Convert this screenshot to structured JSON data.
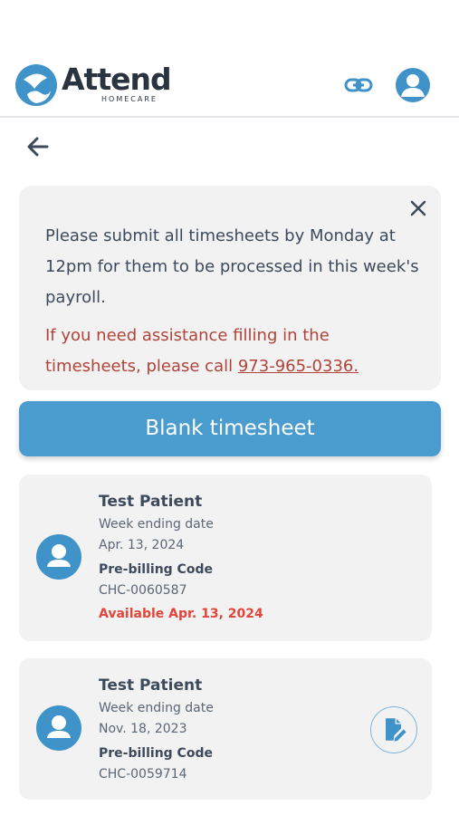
{
  "header": {
    "logo_word": "Attend",
    "logo_sub": "HOMECARE"
  },
  "notice": {
    "text": "Please submit all timesheets by Monday at 12pm for them to be processed in this week's payroll.",
    "help_text": "If you need assistance filling in the timesheets, please call ",
    "phone": "973-965-0336."
  },
  "blank_button": {
    "label": "Blank timesheet"
  },
  "timesheets": [
    {
      "patient": "Test Patient",
      "week_label": "Week ending date",
      "week_date": "Apr. 13, 2024",
      "code_label": "Pre-billing Code",
      "code": "CHC-0060587",
      "availability": "Available Apr. 13, 2024"
    },
    {
      "patient": "Test Patient",
      "week_label": "Week ending date",
      "week_date": "Nov. 18, 2023",
      "code_label": "Pre-billing Code",
      "code": "CHC-0059714"
    }
  ],
  "colors": {
    "accent": "#4a9ccf",
    "warning_text": "#b0443a",
    "available_text": "#e0473a",
    "card_bg": "#f2f2f3"
  },
  "icons": {
    "back": "arrow-left-icon",
    "close": "close-icon",
    "link": "link-icon",
    "avatar": "user-icon",
    "patient": "user-icon",
    "edit": "edit-document-icon"
  }
}
